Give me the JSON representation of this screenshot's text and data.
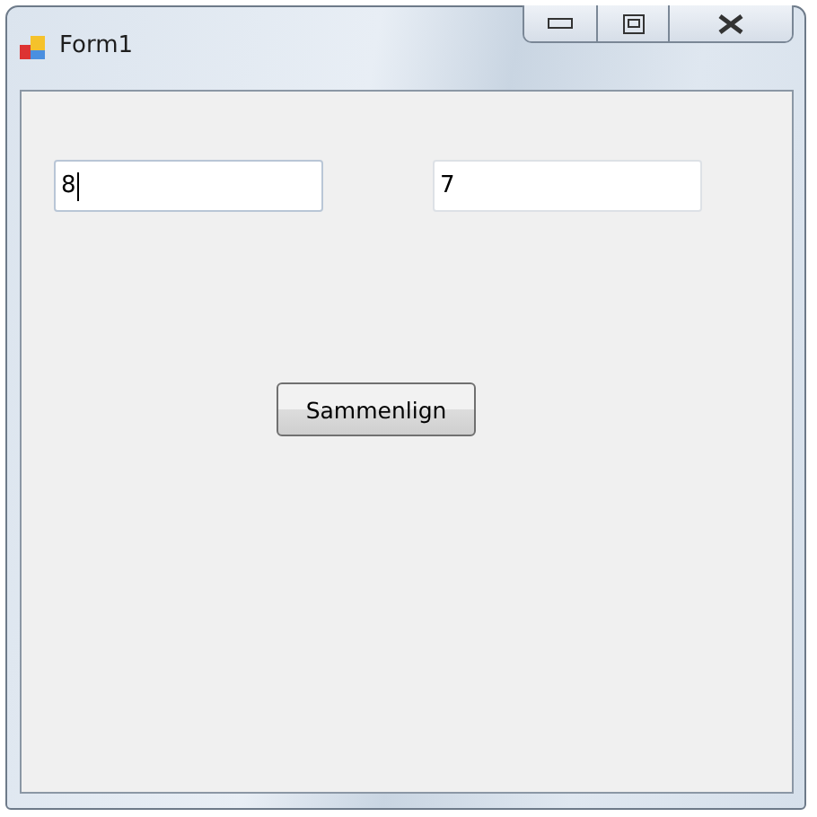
{
  "window": {
    "title": "Form1"
  },
  "fields": [
    {
      "value": "8",
      "focused": true
    },
    {
      "value": "7",
      "focused": false
    }
  ],
  "button": {
    "label": "Sammenlign"
  }
}
